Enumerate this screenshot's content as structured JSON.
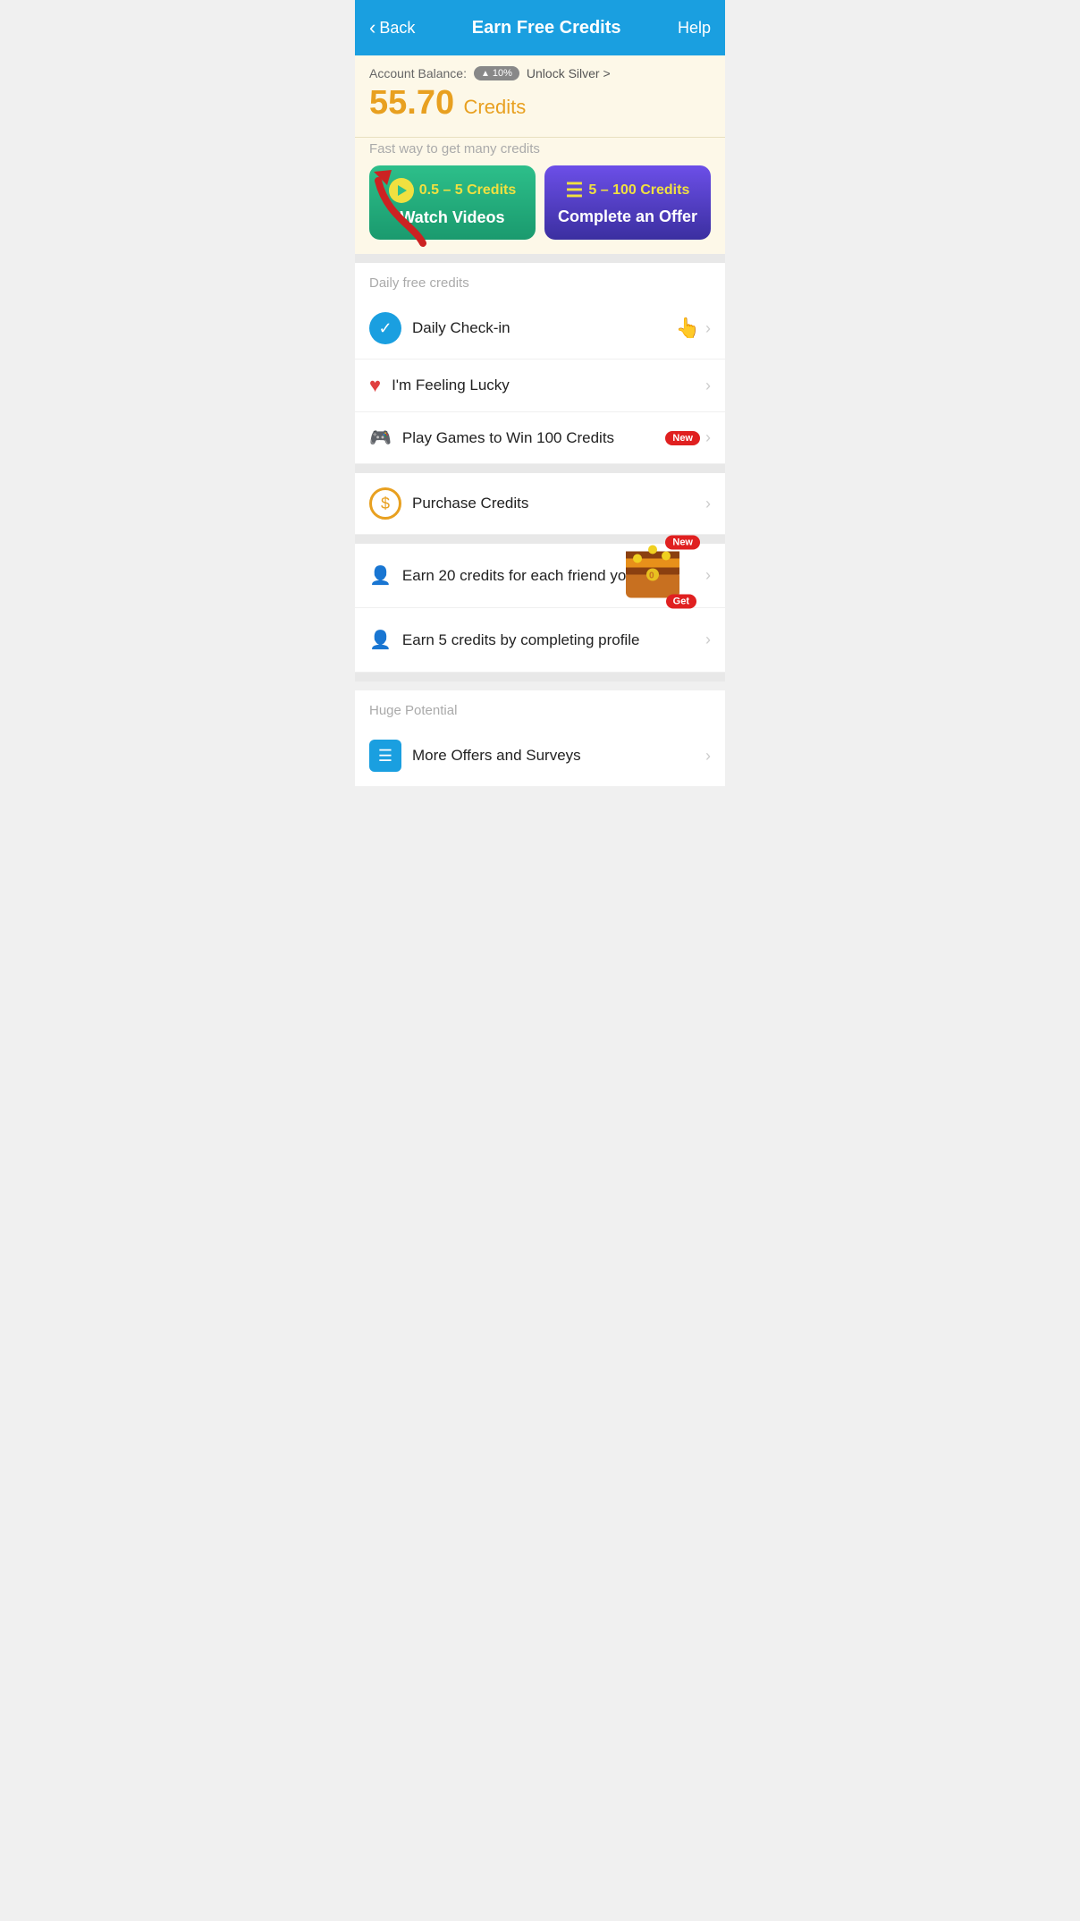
{
  "header": {
    "back_label": "Back",
    "title": "Earn Free Credits",
    "help_label": "Help"
  },
  "account": {
    "balance_label": "Account Balance:",
    "tier_percent": "10%",
    "unlock_label": "Unlock Silver >",
    "credits_amount": "55.70",
    "credits_unit": "Credits"
  },
  "fast_way": {
    "label": "Fast way to get many credits"
  },
  "watch_videos": {
    "credit_range": "0.5 – 5 Credits",
    "label": "Watch Videos"
  },
  "complete_offer": {
    "credit_range": "5 – 100 Credits",
    "label": "Complete an Offer"
  },
  "daily_section": {
    "label": "Daily free credits"
  },
  "daily_items": [
    {
      "id": "daily-checkin",
      "text": "Daily Check-in",
      "icon_type": "check",
      "has_hand": true,
      "has_new": false
    },
    {
      "id": "feeling-lucky",
      "text": "I'm Feeling Lucky",
      "icon_type": "heart",
      "has_hand": false,
      "has_new": false
    },
    {
      "id": "play-games",
      "text": "Play Games to Win 100 Credits",
      "icon_type": "gamepad",
      "has_hand": false,
      "has_new": true
    }
  ],
  "purchase": {
    "text": "Purchase Credits"
  },
  "invite_items": [
    {
      "text": "Earn 20 credits for each friend you invite",
      "icon_type": "user-add"
    },
    {
      "text": "Earn 5 credits by completing profile",
      "icon_type": "profile"
    }
  ],
  "huge_section": {
    "label": "Huge Potential"
  },
  "more_offers": {
    "text": "More Offers and Surveys"
  },
  "badges": {
    "new_label": "New",
    "get_label": "Get"
  }
}
